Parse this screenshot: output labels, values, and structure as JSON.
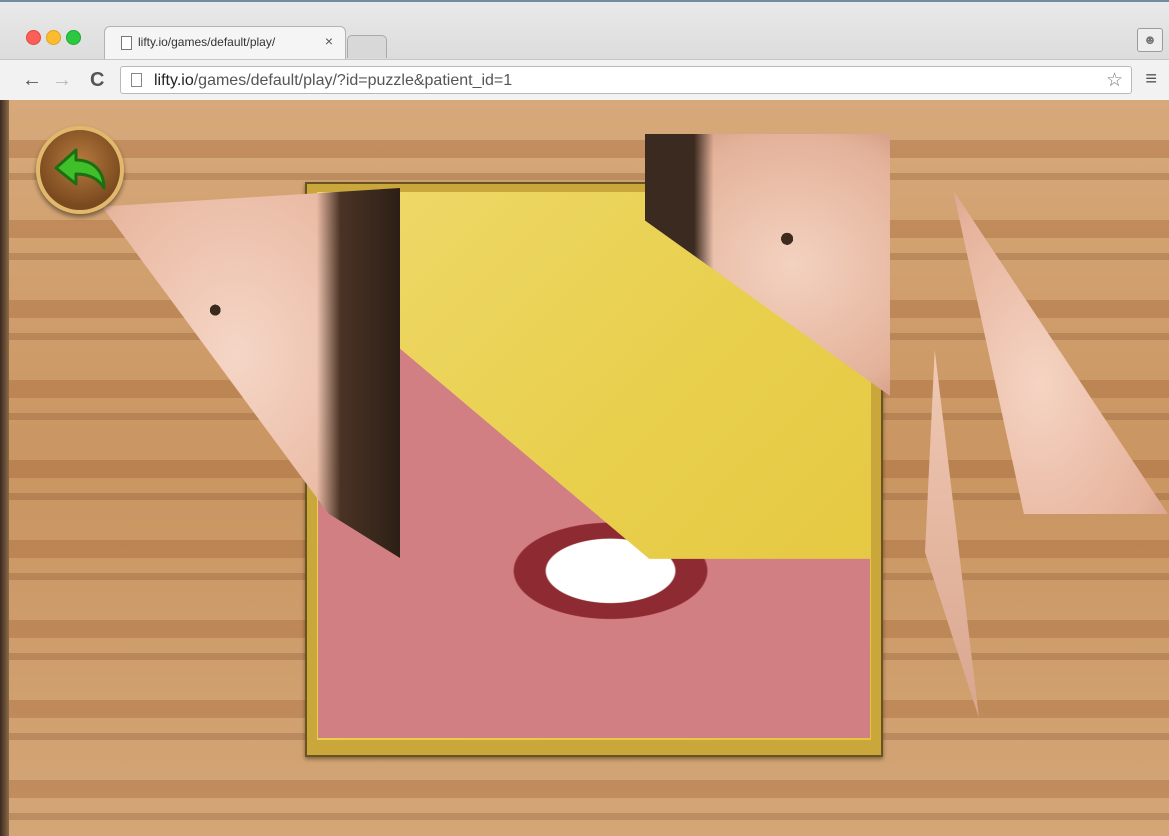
{
  "browser": {
    "tab_title": "lifty.io/games/default/play/",
    "tab_close": "×",
    "url_host": "lifty.io",
    "url_path": "/games/default/play/?id=puzzle&patient_id=1",
    "icons": {
      "back": "arrow-left-icon",
      "forward": "arrow-right-icon",
      "reload": "reload-icon",
      "bookmark": "star-icon",
      "menu": "hamburger-menu-icon",
      "profile": "user-icon",
      "page": "page-icon"
    }
  },
  "game": {
    "back_button_icon": "undo-arrow-icon",
    "colors": {
      "board_yellow": "#e8cf4c",
      "back_arrow_green": "#3fbf2a",
      "wood": "#c99561"
    }
  }
}
